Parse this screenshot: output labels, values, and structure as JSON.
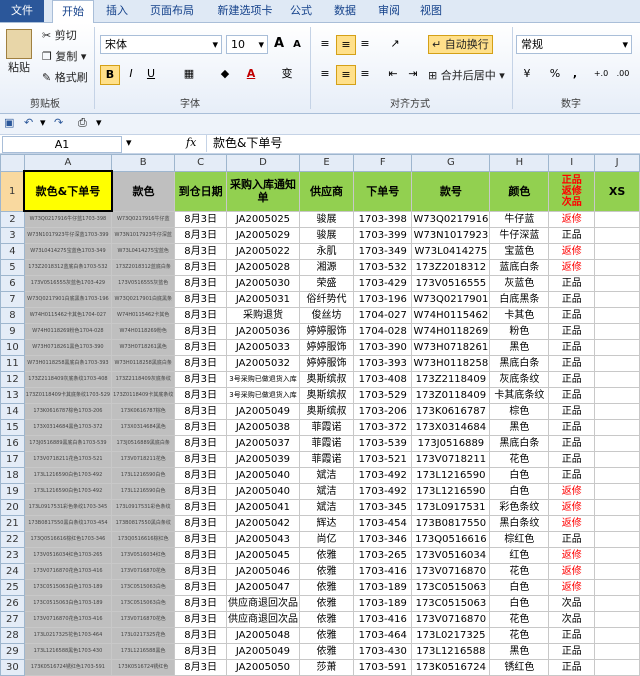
{
  "ribbon_tabs": [
    "文件",
    "开始",
    "插入",
    "页面布局",
    "新建选项卡",
    "公式",
    "数据",
    "审阅",
    "视图"
  ],
  "clipboard": {
    "paste": "粘贴",
    "cut": "剪切",
    "copy": "复制",
    "format_painter": "格式刷",
    "group": "剪贴板"
  },
  "font": {
    "name": "宋体",
    "size": "10",
    "bold": "B",
    "italic": "I",
    "underline": "U",
    "grow": "A",
    "shrink": "A",
    "color_letter": "A",
    "pinyin": "变",
    "group": "字体"
  },
  "alignment": {
    "wrap_text": "自动换行",
    "merge_center": "合并后居中",
    "group": "对齐方式"
  },
  "number": {
    "format": "常规",
    "percent": "%",
    "comma": ",",
    "group": "数字"
  },
  "formula_bar": {
    "name_box": "A1",
    "fx": "fx",
    "content": "款色&下单号"
  },
  "colors": {
    "header_green": "#92d050",
    "header_yellow": "#ffff00",
    "header_gray": "#bfbfbf",
    "status_red": "#ff0000",
    "selected_header": "#f9d99f"
  },
  "columns": [
    "A",
    "B",
    "C",
    "D",
    "E",
    "F",
    "G",
    "H",
    "I",
    "J"
  ],
  "headers": [
    "款色&下单号",
    "款色",
    "到仓日期",
    "采购入库通知单",
    "供应商",
    "下单号",
    "款号",
    "颜色",
    "正品\n返修\n次品",
    "XS"
  ],
  "rows": [
    {
      "n": "2",
      "a": "W73Q0217916牛仔蓝1703-398",
      "b": "W73Q0217916牛仔蓝",
      "c": "8月3日",
      "d": "JA2005025",
      "e": "骏展",
      "f": "1703-398",
      "g": "W73Q0217916",
      "h": "牛仔蓝",
      "i": "返修"
    },
    {
      "n": "3",
      "a": "W73N1017923牛仔深蓝1703-399",
      "b": "W73N1017923牛仔深蓝",
      "c": "8月3日",
      "d": "JA2005029",
      "e": "骏展",
      "f": "1703-399",
      "g": "W73N1017923",
      "h": "牛仔深蓝",
      "i": "正品"
    },
    {
      "n": "4",
      "a": "W73L0414275宝蓝色1703-349",
      "b": "W73L0414275宝蓝色",
      "c": "8月3日",
      "d": "JA2005022",
      "e": "永肌",
      "f": "1703-349",
      "g": "W73L0414275",
      "h": "宝蓝色",
      "i": "返修"
    },
    {
      "n": "5",
      "a": "173Z2018312蓝底白条1703-532",
      "b": "173Z2018312蓝底白条",
      "c": "8月3日",
      "d": "JA2005028",
      "e": "湘源",
      "f": "1703-532",
      "g": "173Z2018312",
      "h": "蓝底白条",
      "i": "返修"
    },
    {
      "n": "6",
      "a": "173V0516555灰蓝色1703-429",
      "b": "173V0516555灰蓝色",
      "c": "8月3日",
      "d": "JA2005030",
      "e": "荣盛",
      "f": "1703-429",
      "g": "173V0516555",
      "h": "灰蓝色",
      "i": "正品"
    },
    {
      "n": "7",
      "a": "W73Q0217901白底黑条1703-196",
      "b": "W73Q0217901白底黑条",
      "c": "8月3日",
      "d": "JA2005031",
      "e": "俗纤势代",
      "f": "1703-196",
      "g": "W73Q0217901",
      "h": "白底黑条",
      "i": "正品"
    },
    {
      "n": "8",
      "a": "W74H0115462卡其色1704-027",
      "b": "W74H0115462卡其色",
      "c": "8月3日",
      "d": "采购退货",
      "e": "俊丝坊",
      "f": "1704-027",
      "g": "W74H0115462",
      "h": "卡其色",
      "i": "正品"
    },
    {
      "n": "9",
      "a": "W74H0118269粉色1704-028",
      "b": "W74H0118269粉色",
      "c": "8月3日",
      "d": "JA2005036",
      "e": "婷婷服饰",
      "f": "1704-028",
      "g": "W74H0118269",
      "h": "粉色",
      "i": "正品"
    },
    {
      "n": "10",
      "a": "W73H0718261黑色1703-390",
      "b": "W73H0718261黑色",
      "c": "8月3日",
      "d": "JA2005033",
      "e": "婷婷服饰",
      "f": "1703-390",
      "g": "W73H0718261",
      "h": "黑色",
      "i": "正品"
    },
    {
      "n": "11",
      "a": "W73H0118258黑底白条1703-393",
      "b": "W73H0118258黑底白条",
      "c": "8月3日",
      "d": "JA2005032",
      "e": "婷婷服饰",
      "f": "1703-393",
      "g": "W73H0118258",
      "h": "黑底白条",
      "i": "正品"
    },
    {
      "n": "12",
      "a": "173Z2118409灰底条纹1703-408",
      "b": "173Z2118409灰底条纹",
      "c": "8月3日",
      "d": "3号采购已做退货入库",
      "e": "奥斯缤叔",
      "f": "1703-408",
      "g": "173Z2118409",
      "h": "灰底条纹",
      "i": "正品"
    },
    {
      "n": "13",
      "a": "173Z0118409卡其底条纹1703-529",
      "b": "173Z0118409卡其底条纹",
      "c": "8月3日",
      "d": "3号采购已做退货入库",
      "e": "奥斯缤叔",
      "f": "1703-529",
      "g": "173Z0118409",
      "h": "卡其底条纹",
      "i": "正品"
    },
    {
      "n": "14",
      "a": "173K0616787棕色1703-206",
      "b": "173K0616787棕色",
      "c": "8月3日",
      "d": "JA2005049",
      "e": "奥斯缤叔",
      "f": "1703-206",
      "g": "173K0616787",
      "h": "棕色",
      "i": "正品"
    },
    {
      "n": "15",
      "a": "173X0314684黑色1703-372",
      "b": "173X0314684黑色",
      "c": "8月3日",
      "d": "JA2005038",
      "e": "菲霞诺",
      "f": "1703-372",
      "g": "173X0314684",
      "h": "黑色",
      "i": "正品"
    },
    {
      "n": "16",
      "a": "173J0516889黑底白条1703-539",
      "b": "173J0516889黑底白条",
      "c": "8月3日",
      "d": "JA2005037",
      "e": "菲霞诺",
      "f": "1703-539",
      "g": "173J0516889",
      "h": "黑底白条",
      "i": "正品"
    },
    {
      "n": "17",
      "a": "173V0718211花色1703-521",
      "b": "173V0718211花色",
      "c": "8月3日",
      "d": "JA2005039",
      "e": "菲霞诺",
      "f": "1703-521",
      "g": "173V0718211",
      "h": "花色",
      "i": "正品"
    },
    {
      "n": "18",
      "a": "173L1216590白色1703-492",
      "b": "173L1216590白色",
      "c": "8月3日",
      "d": "JA2005040",
      "e": "斌洁",
      "f": "1703-492",
      "g": "173L1216590",
      "h": "白色",
      "i": "正品"
    },
    {
      "n": "19",
      "a": "173L1216590白色1703-492",
      "b": "173L1216590白色",
      "c": "8月3日",
      "d": "JA2005040",
      "e": "斌洁",
      "f": "1703-492",
      "g": "173L1216590",
      "h": "白色",
      "i": "返修"
    },
    {
      "n": "20",
      "a": "173L0917531彩色条纹1703-345",
      "b": "173L0917531彩色条纹",
      "c": "8月3日",
      "d": "JA2005041",
      "e": "斌洁",
      "f": "1703-345",
      "g": "173L0917531",
      "h": "彩色条纹",
      "i": "返修"
    },
    {
      "n": "21",
      "a": "173B0817550黑白条纹1703-454",
      "b": "173B0817550黑白条纹",
      "c": "8月3日",
      "d": "JA2005042",
      "e": "辉达",
      "f": "1703-454",
      "g": "173B0817550",
      "h": "黑白条纹",
      "i": "返修"
    },
    {
      "n": "22",
      "a": "173Q0516616棕红色1703-346",
      "b": "173Q0516616棕红色",
      "c": "8月3日",
      "d": "JA2005043",
      "e": "尚亿",
      "f": "1703-346",
      "g": "173Q0516616",
      "h": "棕红色",
      "i": "正品"
    },
    {
      "n": "23",
      "a": "173V0516034红色1703-265",
      "b": "173V0516034红色",
      "c": "8月3日",
      "d": "JA2005045",
      "e": "依雅",
      "f": "1703-265",
      "g": "173V0516034",
      "h": "红色",
      "i": "返修"
    },
    {
      "n": "24",
      "a": "173V0716870花色1703-416",
      "b": "173V0716870花色",
      "c": "8月3日",
      "d": "JA2005046",
      "e": "依雅",
      "f": "1703-416",
      "g": "173V0716870",
      "h": "花色",
      "i": "返修"
    },
    {
      "n": "25",
      "a": "173C0515063白色1703-189",
      "b": "173C0515063白色",
      "c": "8月3日",
      "d": "JA2005047",
      "e": "依雅",
      "f": "1703-189",
      "g": "173C0515063",
      "h": "白色",
      "i": "返修"
    },
    {
      "n": "26",
      "a": "173C0515063白色1703-189",
      "b": "173C0515063白色",
      "c": "8月3日",
      "d": "供应商退回次品",
      "e": "依雅",
      "f": "1703-189",
      "g": "173C0515063",
      "h": "白色",
      "i": "次品"
    },
    {
      "n": "27",
      "a": "173V0716870花色1703-416",
      "b": "173V0716870花色",
      "c": "8月3日",
      "d": "供应商退回次品",
      "e": "依雅",
      "f": "1703-416",
      "g": "173V0716870",
      "h": "花色",
      "i": "次品"
    },
    {
      "n": "28",
      "a": "173L0217325花色1703-464",
      "b": "173L0217325花色",
      "c": "8月3日",
      "d": "JA2005048",
      "e": "依雅",
      "f": "1703-464",
      "g": "173L0217325",
      "h": "花色",
      "i": "正品"
    },
    {
      "n": "29",
      "a": "173L1216588黑色1703-430",
      "b": "173L1216588黑色",
      "c": "8月3日",
      "d": "JA2005049",
      "e": "依雅",
      "f": "1703-430",
      "g": "173L1216588",
      "h": "黑色",
      "i": "正品"
    },
    {
      "n": "30",
      "a": "173K0516724锈红色1703-591",
      "b": "173K0516724锈红色",
      "c": "8月3日",
      "d": "JA2005050",
      "e": "莎萧",
      "f": "1703-591",
      "g": "173K0516724",
      "h": "锈红色",
      "i": "正品"
    }
  ]
}
